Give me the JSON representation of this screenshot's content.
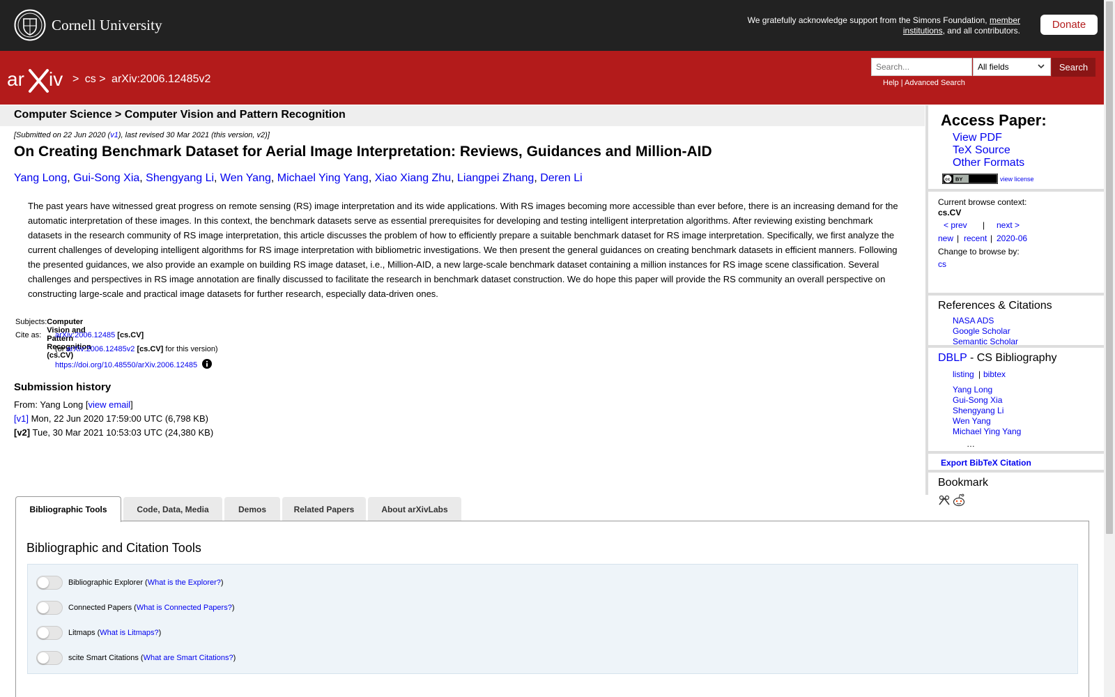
{
  "topbar": {
    "university": "Cornell University",
    "support_text": "We gratefully acknowledge support from the Simons Foundation,",
    "support_link": "member institutions",
    "support_tail": ", and all contributors.",
    "donate": "Donate"
  },
  "header": {
    "crumb_sep": ">",
    "crumb_1": "cs",
    "crumb_2": "arXiv:2006.12485v2",
    "search_placeholder": "Search...",
    "search_field": "All fields",
    "search_button": "Search",
    "help": "Help",
    "sep": "|",
    "advanced": "Advanced Search"
  },
  "paper": {
    "subject_heading": "Computer Science > Computer Vision and Pattern Recognition",
    "dateline_pre": "[Submitted on 22 Jun 2020 (",
    "dateline_v1": "v1",
    "dateline_post": "), last revised 30 Mar 2021 (this version, v2)]",
    "title": "On Creating Benchmark Dataset for Aerial Image Interpretation: Reviews, Guidances and Million-AID",
    "authors": [
      "Yang Long",
      "Gui-Song Xia",
      "Shengyang Li",
      "Wen Yang",
      "Michael Ying Yang",
      "Xiao Xiang Zhu",
      "Liangpei Zhang",
      "Deren Li"
    ],
    "abstract": "The past years have witnessed great progress on remote sensing (RS) image interpretation and its wide applications. With RS images becoming more accessible than ever before, there is an increasing demand for the automatic interpretation of these images. In this context, the benchmark datasets serve as essential prerequisites for developing and testing intelligent interpretation algorithms. After reviewing existing benchmark datasets in the research community of RS image interpretation, this article discusses the problem of how to efficiently prepare a suitable benchmark dataset for RS image interpretation. Specifically, we first analyze the current challenges of developing intelligent algorithms for RS image interpretation with bibliometric investigations. We then present the general guidances on creating benchmark datasets in efficient manners. Following the presented guidances, we also provide an example on building RS image dataset, i.e., Million-AID, a new large-scale benchmark dataset containing a million instances for RS image scene classification. Several challenges and perspectives in RS image annotation are finally discussed to facilitate the research in benchmark dataset construction. We do hope this paper will provide the RS community an overall perspective on constructing large-scale and practical image datasets for further research, especially data-driven ones.",
    "subjects_label": "Subjects:",
    "subjects_value": "Computer Vision and Pattern Recognition (cs.CV)",
    "cite_label": "Cite as:",
    "cite_id": "arXiv:2006.12485",
    "cite_tag": "[cs.CV]",
    "cite2_pre": "(or",
    "cite2_id": "arXiv:2006.12485v2",
    "cite2_tag": "[cs.CV]",
    "cite2_post": "for this version)",
    "doi": "https://doi.org/10.48550/arXiv.2006.12485"
  },
  "history": {
    "title": "Submission history",
    "from_pre": "From: Yang Long [",
    "view_email": "view email",
    "from_post": "]",
    "v1_label": "[v1]",
    "v1_text": "Mon, 22 Jun 2020 17:59:00 UTC (6,798 KB)",
    "v2_label": "[v2]",
    "v2_text": "Tue, 30 Mar 2021 10:53:03 UTC (24,380 KB)"
  },
  "sidebar": {
    "access_title": "Access Paper:",
    "view_pdf": "View PDF",
    "tex_source": "TeX Source",
    "other_formats": "Other Formats",
    "view_license": "view license",
    "browse_context_label": "Current browse context:",
    "browse_context": "cs.CV",
    "prev": "< prev",
    "pipe": "|",
    "next": "next >",
    "new": "new",
    "recent": "recent",
    "month": "2020-06",
    "change_browse": "Change to browse by:",
    "cs": "cs",
    "refs_title": "References & Citations",
    "nasa": "NASA ADS",
    "google": "Google Scholar",
    "semantic": "Semantic Scholar",
    "dblp": "DBLP",
    "dblp_rest": " - CS Bibliography",
    "listing": "listing",
    "bibtex": "bibtex",
    "dblp_authors": [
      "Yang Long",
      "Gui-Song Xia",
      "Shengyang Li",
      "Wen Yang",
      "Michael Ying Yang"
    ],
    "ellipsis": "…",
    "export": "Export BibTeX Citation",
    "bookmark": "Bookmark"
  },
  "tabs": [
    "Bibliographic Tools",
    "Code, Data, Media",
    "Demos",
    "Related Papers",
    "About arXivLabs"
  ],
  "tools": {
    "title": "Bibliographic and Citation Tools",
    "items": [
      {
        "label": "Bibliographic Explorer",
        "link": "What is the Explorer?"
      },
      {
        "label": "Connected Papers",
        "link": "What is Connected Papers?"
      },
      {
        "label": "Litmaps",
        "link": "What is Litmaps?"
      },
      {
        "label": "scite Smart Citations",
        "link": "What are Smart Citations?"
      }
    ]
  },
  "colors": {
    "brand_red": "#b31b1b",
    "dark_bar": "#222222",
    "link": "#0000ee"
  }
}
